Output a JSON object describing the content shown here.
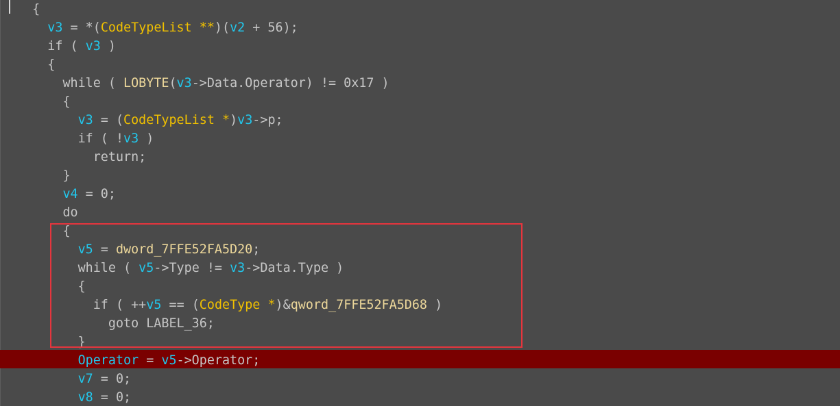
{
  "colors": {
    "background": "#4a4a4a",
    "text": "#c6c6c6",
    "variable": "#22c7ec",
    "type": "#f0c000",
    "global": "#ecd79a",
    "highlight_line": "#7a0000",
    "selection_box": "#e6353d"
  },
  "highlighted_line_index": 18,
  "boxed_lines": [
    12,
    17
  ],
  "lines": [
    {
      "indent": "  ",
      "tokens": [
        {
          "t": "{",
          "c": "plain"
        }
      ]
    },
    {
      "indent": "    ",
      "tokens": [
        {
          "t": "v3",
          "c": "var"
        },
        {
          "t": " = *(",
          "c": "plain"
        },
        {
          "t": "CodeTypeList",
          "c": "type"
        },
        {
          "t": " **",
          "c": "type"
        },
        {
          "t": ")(",
          "c": "plain"
        },
        {
          "t": "v2",
          "c": "var"
        },
        {
          "t": " + 56);",
          "c": "plain"
        }
      ]
    },
    {
      "indent": "    ",
      "tokens": [
        {
          "t": "if",
          "c": "kw"
        },
        {
          "t": " ( ",
          "c": "plain"
        },
        {
          "t": "v3",
          "c": "var"
        },
        {
          "t": " )",
          "c": "plain"
        }
      ]
    },
    {
      "indent": "    ",
      "tokens": [
        {
          "t": "{",
          "c": "plain"
        }
      ]
    },
    {
      "indent": "      ",
      "tokens": [
        {
          "t": "while",
          "c": "kw"
        },
        {
          "t": " ( ",
          "c": "plain"
        },
        {
          "t": "LOBYTE",
          "c": "glob"
        },
        {
          "t": "(",
          "c": "plain"
        },
        {
          "t": "v3",
          "c": "var"
        },
        {
          "t": "->Data.Operator) != 0x17 )",
          "c": "plain"
        }
      ]
    },
    {
      "indent": "      ",
      "tokens": [
        {
          "t": "{",
          "c": "plain"
        }
      ]
    },
    {
      "indent": "        ",
      "tokens": [
        {
          "t": "v3",
          "c": "var"
        },
        {
          "t": " = (",
          "c": "plain"
        },
        {
          "t": "CodeTypeList",
          "c": "type"
        },
        {
          "t": " *",
          "c": "type"
        },
        {
          "t": ")",
          "c": "plain"
        },
        {
          "t": "v3",
          "c": "var"
        },
        {
          "t": "->p;",
          "c": "plain"
        }
      ]
    },
    {
      "indent": "        ",
      "tokens": [
        {
          "t": "if",
          "c": "kw"
        },
        {
          "t": " ( !",
          "c": "plain"
        },
        {
          "t": "v3",
          "c": "var"
        },
        {
          "t": " )",
          "c": "plain"
        }
      ]
    },
    {
      "indent": "          ",
      "tokens": [
        {
          "t": "return;",
          "c": "kw"
        }
      ]
    },
    {
      "indent": "      ",
      "tokens": [
        {
          "t": "}",
          "c": "plain"
        }
      ]
    },
    {
      "indent": "      ",
      "tokens": [
        {
          "t": "v4",
          "c": "var"
        },
        {
          "t": " = 0;",
          "c": "plain"
        }
      ]
    },
    {
      "indent": "      ",
      "tokens": [
        {
          "t": "do",
          "c": "kw"
        }
      ]
    },
    {
      "indent": "      ",
      "tokens": [
        {
          "t": "{",
          "c": "plain"
        }
      ]
    },
    {
      "indent": "        ",
      "tokens": [
        {
          "t": "v5",
          "c": "var"
        },
        {
          "t": " = ",
          "c": "plain"
        },
        {
          "t": "dword_7FFE52FA5D20",
          "c": "glob"
        },
        {
          "t": ";",
          "c": "plain"
        }
      ]
    },
    {
      "indent": "        ",
      "tokens": [
        {
          "t": "while",
          "c": "kw"
        },
        {
          "t": " ( ",
          "c": "plain"
        },
        {
          "t": "v5",
          "c": "var"
        },
        {
          "t": "->Type != ",
          "c": "plain"
        },
        {
          "t": "v3",
          "c": "var"
        },
        {
          "t": "->Data.Type )",
          "c": "plain"
        }
      ]
    },
    {
      "indent": "        ",
      "tokens": [
        {
          "t": "{",
          "c": "plain"
        }
      ]
    },
    {
      "indent": "          ",
      "tokens": [
        {
          "t": "if",
          "c": "kw"
        },
        {
          "t": " ( ++",
          "c": "plain"
        },
        {
          "t": "v5",
          "c": "var"
        },
        {
          "t": " == (",
          "c": "plain"
        },
        {
          "t": "CodeType",
          "c": "type"
        },
        {
          "t": " *",
          "c": "type"
        },
        {
          "t": ")&",
          "c": "plain"
        },
        {
          "t": "qword_7FFE52FA5D68",
          "c": "glob"
        },
        {
          "t": " )",
          "c": "plain"
        }
      ]
    },
    {
      "indent": "            ",
      "tokens": [
        {
          "t": "goto LABEL_36;",
          "c": "kw"
        }
      ]
    },
    {
      "indent": "        ",
      "tokens": [
        {
          "t": "}",
          "c": "plain"
        }
      ]
    },
    {
      "indent": "        ",
      "tokens": [
        {
          "t": "Operator",
          "c": "var"
        },
        {
          "t": " = ",
          "c": "plain"
        },
        {
          "t": "v5",
          "c": "var"
        },
        {
          "t": "->Operator;",
          "c": "plain"
        }
      ]
    },
    {
      "indent": "        ",
      "tokens": [
        {
          "t": "v7",
          "c": "var"
        },
        {
          "t": " = 0;",
          "c": "plain"
        }
      ]
    },
    {
      "indent": "        ",
      "tokens": [
        {
          "t": "v8",
          "c": "var"
        },
        {
          "t": " = 0;",
          "c": "plain"
        }
      ]
    }
  ]
}
